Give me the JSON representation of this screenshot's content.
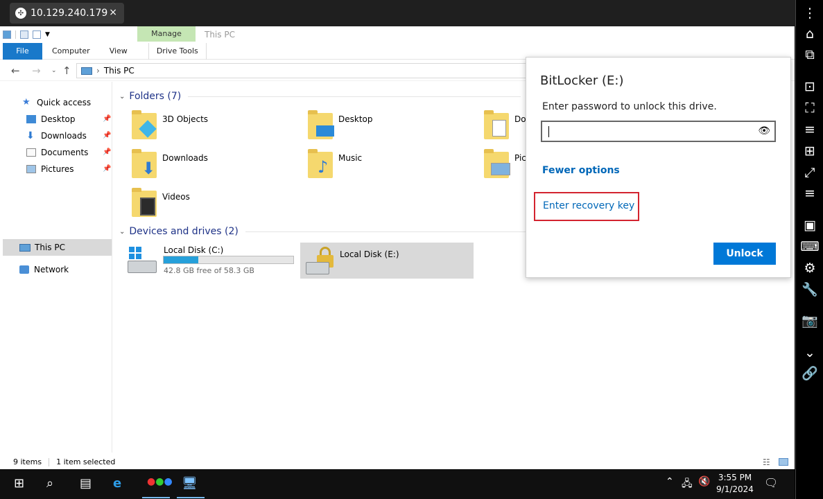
{
  "session": {
    "tab_title": "10.129.240.179",
    "close": "×"
  },
  "ribbon": {
    "context_tab": "Manage",
    "window_title": "This PC",
    "tabs": {
      "file": "File",
      "computer": "Computer",
      "view": "View",
      "drive_tools": "Drive Tools"
    }
  },
  "address": {
    "path": "This PC",
    "sep": "›"
  },
  "nav": {
    "quick_access": "Quick access",
    "items": [
      "Desktop",
      "Downloads",
      "Documents",
      "Pictures"
    ],
    "this_pc": "This PC",
    "network": "Network"
  },
  "content": {
    "folders_header": "Folders (7)",
    "folders": [
      "3D Objects",
      "Desktop",
      "Do",
      "Downloads",
      "Music",
      "Pic",
      "Videos"
    ],
    "drives_header": "Devices and drives (2)",
    "drive_c": {
      "name": "Local Disk (C:)",
      "free": "42.8 GB free of 58.3 GB",
      "used_fraction": 0.27
    },
    "drive_e": {
      "name": "Local Disk (E:)"
    }
  },
  "status": {
    "items": "9 items",
    "selected": "1 item selected"
  },
  "bitlocker": {
    "title": "BitLocker (E:)",
    "prompt": "Enter password to unlock this drive.",
    "fewer_options": "Fewer options",
    "recovery": "Enter recovery key",
    "unlock": "Unlock"
  },
  "taskbar": {
    "time": "3:55 PM",
    "date": "9/1/2024"
  },
  "colors": {
    "accent": "#0078d7",
    "link": "#0067b8",
    "highlight": "#d3232f",
    "manage": "#c5e6b4"
  }
}
